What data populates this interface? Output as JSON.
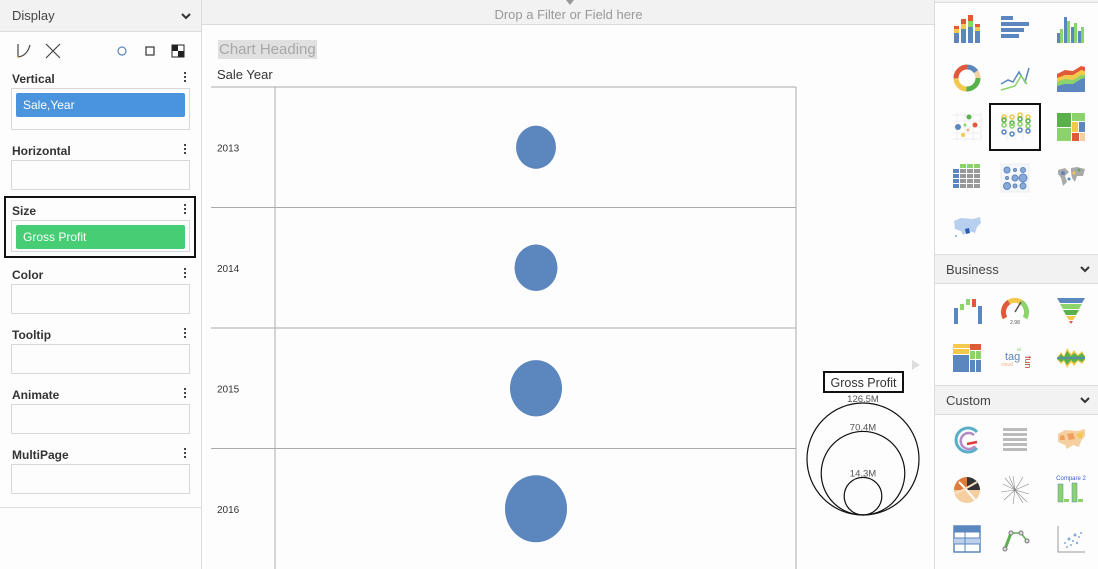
{
  "left_panel": {
    "header": "Display",
    "tools": [
      "lasso-icon",
      "cross-icon",
      "circle-shape-icon",
      "square-shape-icon",
      "checker-icon"
    ],
    "sections": [
      {
        "label": "Vertical",
        "chip": "Sale,Year",
        "chip_color": "#4a94dd"
      },
      {
        "label": "Horizontal",
        "chip": null
      },
      {
        "label": "Size",
        "chip": "Gross Profit",
        "chip_color": "#47cd73",
        "highlighted": true
      },
      {
        "label": "Color",
        "chip": null
      },
      {
        "label": "Tooltip",
        "chip": null
      },
      {
        "label": "Animate",
        "chip": null
      },
      {
        "label": "MultiPage",
        "chip": null
      }
    ]
  },
  "center": {
    "drop_bar": "Drop a Filter or Field here",
    "chart_heading": "Chart Heading",
    "vertical_axis_title": "Sale Year"
  },
  "chart_data": {
    "type": "scatter",
    "subtype": "bubble",
    "title": "Chart Heading",
    "ylabel": "Sale Year",
    "xlabel": "",
    "categories": [
      "2013",
      "2014",
      "2015",
      "2016"
    ],
    "series": [
      {
        "name": "Gross Profit",
        "color": "#5b86be",
        "values": [
          16.1,
          18.6,
          27.3,
          38.8
        ],
        "unit": "M"
      }
    ],
    "size_legend": {
      "title": "Gross Profit",
      "values": [
        126.5,
        70.4,
        14.3
      ],
      "labels": [
        "126.5M",
        "70.4M",
        "14.3M"
      ],
      "position": "right"
    },
    "grid": true
  },
  "right_panel": {
    "general_icons": [
      "stacked-column-chart-icon",
      "bar-chart-icon",
      "grouped-column-chart-icon",
      "donut-chart-icon",
      "line-chart-icon",
      "stacked-area-chart-icon",
      "scatter-chart-icon",
      "bubble-grid-chart-icon",
      "treemap-chart-icon",
      "crosstab-table-icon",
      "bubble-matrix-chart-icon",
      "world-map-icon",
      "us-map-icon"
    ],
    "selected_icon": "bubble-grid-chart-icon",
    "categories": [
      {
        "label": "Business",
        "icons": [
          "waterfall-chart-icon",
          "gauge-chart-icon",
          "funnel-chart-icon",
          "heat-grid-icon",
          "tag-cloud-icon",
          "stream-chart-icon"
        ]
      },
      {
        "label": "Custom",
        "icons": [
          "radial-bar-icon",
          "text-list-icon",
          "choropleth-map-icon",
          "chord-diagram-icon",
          "radial-tree-icon",
          "compare-chart-icon",
          "grid-table-icon",
          "network-graph-icon",
          "scatter-density-icon"
        ]
      }
    ],
    "gauge_value": "2.98",
    "tag_cloud_words": [
      "tag",
      "fun",
      "cloud",
      "ai"
    ],
    "compare_label": "Compare 2"
  }
}
